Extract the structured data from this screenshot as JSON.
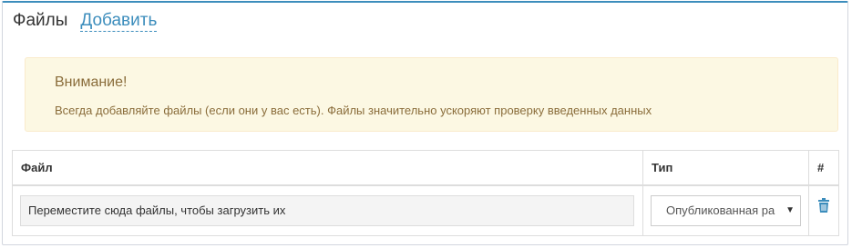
{
  "header": {
    "title": "Файлы",
    "add_label": "Добавить"
  },
  "alert": {
    "title": "Внимание!",
    "text": "Всегда добавляйте файлы (если они у вас есть). Файлы значительно ускоряют проверку введенных данных"
  },
  "table": {
    "columns": [
      "Файл",
      "Тип",
      "#"
    ],
    "row": {
      "drop_text": "Переместите сюда файлы, чтобы загрузить их",
      "type_value": "Опубликованная ра",
      "action_icon": "trash-icon"
    }
  },
  "colors": {
    "accent": "#3c8dbc",
    "alert_bg": "#fcf8e3",
    "alert_text": "#8a6d3b"
  }
}
